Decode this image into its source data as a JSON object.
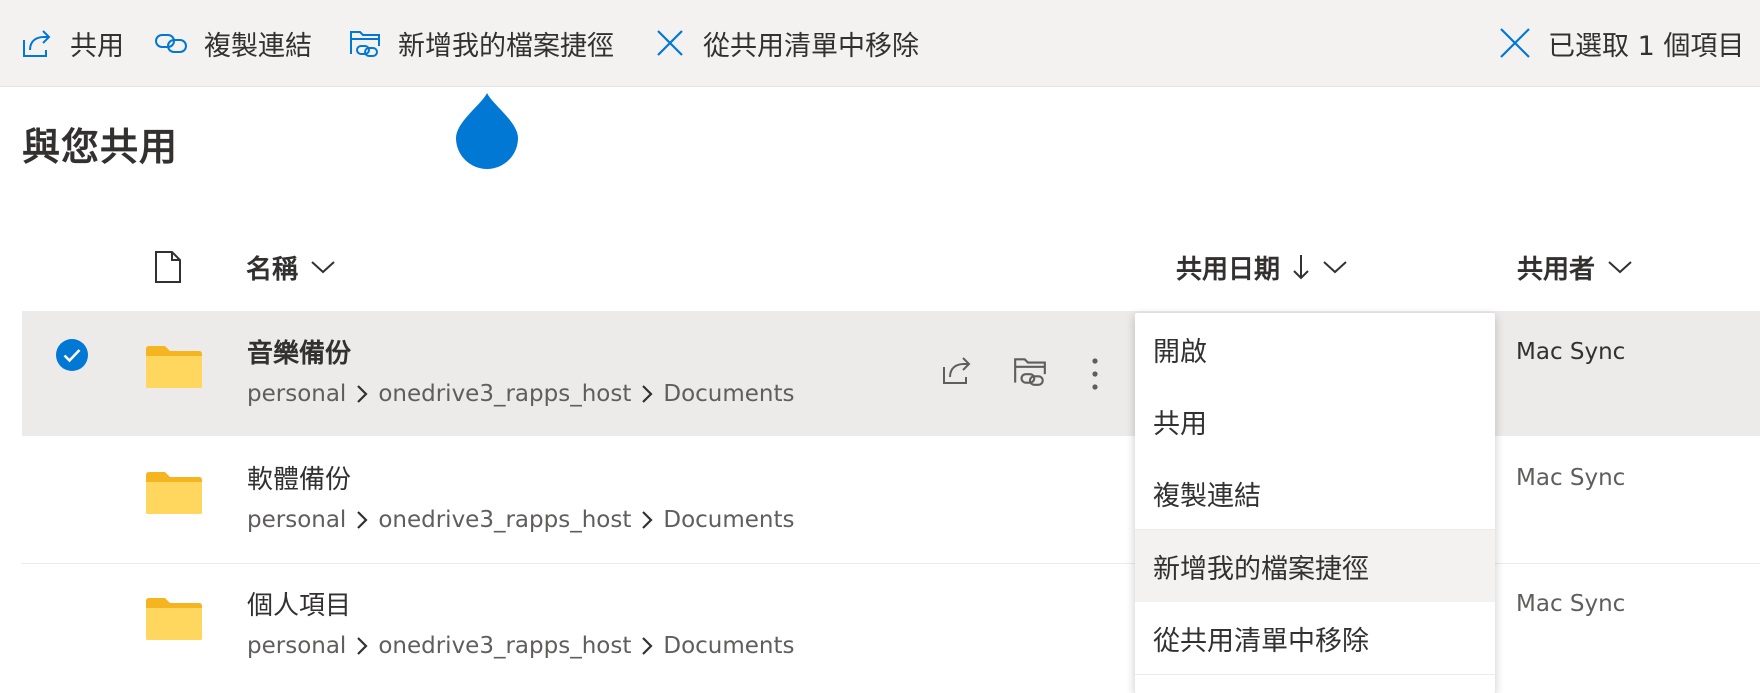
{
  "command_bar": {
    "share_label": "共用",
    "share_icon": "share-icon",
    "copy_link_label": "複製連結",
    "copy_link_icon": "link-icon",
    "add_shortcut_label": "新增我的檔案捷徑",
    "add_shortcut_icon": "folder-shortcut-icon",
    "remove_label": "從共用清單中移除",
    "remove_icon": "close-icon",
    "selection_label": "已選取 1 個項目",
    "selection_icon": "close-icon"
  },
  "page": {
    "title": "與您共用"
  },
  "columns": {
    "file_type_icon": "file-icon",
    "name": "名稱",
    "shared_date": "共用日期",
    "shared_date_sort_icon": "arrow-down-icon",
    "shared_by": "共用者"
  },
  "rows": [
    {
      "name": "音樂備份",
      "path": [
        "personal",
        "onedrive3_rapps_host",
        "Documents"
      ],
      "shared_by": "Mac Sync",
      "selected": true
    },
    {
      "name": "軟體備份",
      "path": [
        "personal",
        "onedrive3_rapps_host",
        "Documents"
      ],
      "shared_by": "Mac Sync",
      "selected": false
    },
    {
      "name": "個人項目",
      "path": [
        "personal",
        "onedrive3_rapps_host",
        "Documents"
      ],
      "shared_by": "Mac Sync",
      "selected": false
    }
  ],
  "row_actions": [
    "share-icon",
    "folder-shortcut-icon",
    "more-vertical-icon"
  ],
  "context_menu": {
    "items": [
      "開啟",
      "共用",
      "複製連結",
      "新增我的檔案捷徑",
      "從共用清單中移除"
    ],
    "hovered": "新增我的檔案捷徑"
  },
  "colors": {
    "accent": "#0078d4",
    "command_bar_bg": "#f3f2f1",
    "selected_row_bg": "#edebe9",
    "folder_yellow": "#ffd75e",
    "folder_tab": "#f5b520"
  }
}
